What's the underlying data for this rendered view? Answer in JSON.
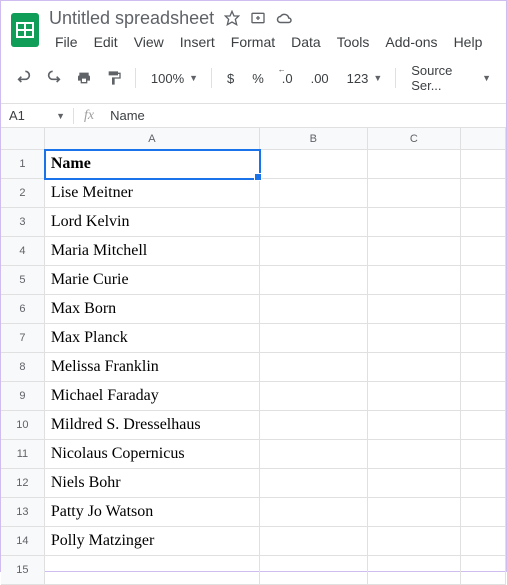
{
  "header": {
    "doc_title": "Untitled spreadsheet",
    "menus": [
      "File",
      "Edit",
      "View",
      "Insert",
      "Format",
      "Data",
      "Tools",
      "Add-ons",
      "Help"
    ]
  },
  "toolbar": {
    "zoom": "100%",
    "dollar": "$",
    "percent": "%",
    "dec_dec": ".0",
    "dec_inc": ".00",
    "numfmt": "123",
    "font": "Source Ser..."
  },
  "namebox": "A1",
  "formula": "Name",
  "columns": [
    "A",
    "B",
    "C",
    ""
  ],
  "rows": [
    {
      "n": "1",
      "a": "Name",
      "bold": true,
      "sel": true
    },
    {
      "n": "2",
      "a": "Lise Meitner"
    },
    {
      "n": "3",
      "a": "Lord Kelvin"
    },
    {
      "n": "4",
      "a": "Maria Mitchell"
    },
    {
      "n": "5",
      "a": "Marie Curie"
    },
    {
      "n": "6",
      "a": "Max Born"
    },
    {
      "n": "7",
      "a": "Max Planck"
    },
    {
      "n": "8",
      "a": "Melissa Franklin"
    },
    {
      "n": "9",
      "a": "Michael Faraday"
    },
    {
      "n": "10",
      "a": "Mildred S. Dresselhaus"
    },
    {
      "n": "11",
      "a": "Nicolaus Copernicus"
    },
    {
      "n": "12",
      "a": "Niels Bohr"
    },
    {
      "n": "13",
      "a": "Patty Jo Watson"
    },
    {
      "n": "14",
      "a": "Polly Matzinger"
    },
    {
      "n": "15",
      "a": ""
    }
  ]
}
